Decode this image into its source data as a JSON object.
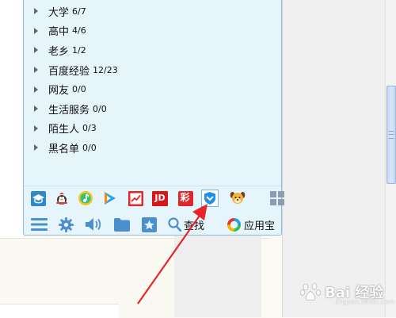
{
  "groups": [
    {
      "name": "大学",
      "count": "6/7"
    },
    {
      "name": "高中",
      "count": "4/6"
    },
    {
      "name": "老乡",
      "count": "1/2"
    },
    {
      "name": "百度经验",
      "count": "12/23"
    },
    {
      "name": "网友",
      "count": "0/0"
    },
    {
      "name": "生活服务",
      "count": "0/0"
    },
    {
      "name": "陌生人",
      "count": "0/3"
    },
    {
      "name": "黑名单",
      "count": "0/0"
    }
  ],
  "apps": {
    "jd_label": "JD",
    "lottery_label": "彩"
  },
  "tools": {
    "search_label": "查找",
    "app_store_label": "应用宝"
  },
  "watermark": {
    "text": "Bai  经验",
    "sub": "jingyan.baidu.com"
  },
  "colors": {
    "panel_bg": "#e6f4fc",
    "panel_border": "#8fb9d9",
    "arrow": "#e8262a",
    "icon_blue": "#2e88c9",
    "tool_icon": "#4b8fcf"
  }
}
